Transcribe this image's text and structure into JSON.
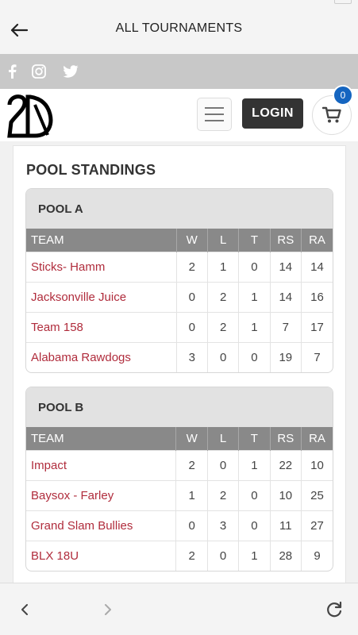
{
  "appbar": {
    "title": "ALL TOURNAMENTS"
  },
  "social": [
    "facebook-icon",
    "instagram-icon",
    "twitter-icon"
  ],
  "header": {
    "login_label": "LOGIN",
    "cart_count": "0"
  },
  "page": {
    "title": "POOL STANDINGS"
  },
  "columns": [
    "TEAM",
    "W",
    "L",
    "T",
    "RS",
    "RA"
  ],
  "pools": [
    {
      "name": "POOL A",
      "rows": [
        [
          "Sticks- Hamm",
          "2",
          "1",
          "0",
          "14",
          "14"
        ],
        [
          "Jacksonville Juice",
          "0",
          "2",
          "1",
          "14",
          "16"
        ],
        [
          "Team 158",
          "0",
          "2",
          "1",
          "7",
          "17"
        ],
        [
          "Alabama Rawdogs",
          "3",
          "0",
          "0",
          "19",
          "7"
        ]
      ]
    },
    {
      "name": "POOL B",
      "rows": [
        [
          "Impact",
          "2",
          "0",
          "1",
          "22",
          "10"
        ],
        [
          "Baysox - Farley",
          "1",
          "2",
          "0",
          "10",
          "25"
        ],
        [
          "Grand Slam Bullies",
          "0",
          "3",
          "0",
          "11",
          "27"
        ],
        [
          "BLX 18U",
          "2",
          "0",
          "1",
          "28",
          "9"
        ]
      ]
    }
  ],
  "colors": {
    "team_link": "#b02c3c",
    "header_row": "#898989",
    "badge": "#1565c0",
    "login_bg": "#333333"
  }
}
